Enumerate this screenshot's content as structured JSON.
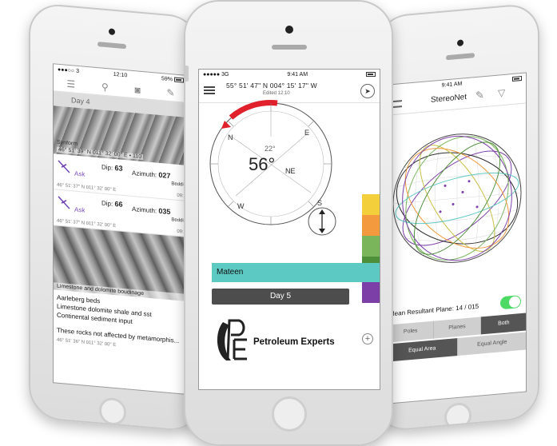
{
  "left_phone": {
    "status": {
      "carrier": "●●●○○ 3",
      "time": "12:10",
      "battery": "59%"
    },
    "day_label": "Day 4",
    "top_image": {
      "caption_title": "Synform",
      "caption_coord": "46° 51' 39\" N  011° 32' 00\" E  • 110",
      "time": "09:4"
    },
    "observations": [
      {
        "ask": "Ask",
        "dip_label": "Dip:",
        "dip_value": "63",
        "az_label": "Azimuth:",
        "az_value": "027",
        "type": "Beddin",
        "coord": "46° 51' 37\" N  011° 32' 00\" E",
        "time": "09:3"
      },
      {
        "ask": "Ask",
        "dip_label": "Dip:",
        "dip_value": "66",
        "az_label": "Azimuth:",
        "az_value": "035",
        "type": "Beddin",
        "coord": "46° 51' 37\" N  011° 32' 00\" E",
        "time": "09:3"
      }
    ],
    "bottom_image": {
      "caption": "Limestone and dolomite boudinage"
    },
    "notes": [
      "Aarleberg beds",
      "Limestone dolomite shale and sst",
      "Continental sediment input"
    ],
    "notes_extra": "These rocks not affected by metamorphis...",
    "footer_coord": "46° 51' 36\" N  011° 32' 00\" E"
  },
  "center_phone": {
    "status": {
      "carrier": "●●●●● 3G",
      "time": "9:41 AM",
      "battery": ""
    },
    "coords": "55° 51' 47\" N   004° 15' 17\" W",
    "edited": "Edited 12:10",
    "compass": {
      "dip_angle": "22°",
      "strike_value": "56°",
      "strike_dir": "NE",
      "cardinal_n": "N",
      "cardinal_e": "E",
      "cardinal_s": "S",
      "cardinal_w": "W"
    },
    "colorbar": [
      "#f3cf3c",
      "#f49a3e",
      "#7ab55c",
      "#4e8f3a",
      "#7c3fa8"
    ],
    "mateen_label": "Mateen",
    "day_button": "Day 5",
    "logo_text": "Petroleum Experts"
  },
  "right_phone": {
    "status": {
      "time": "9:41 AM"
    },
    "title": "StereoNet",
    "mean_label": "Mean Resultant Plane:",
    "mean_value": "14 / 015",
    "toggle_on": true,
    "segment1": [
      "Poles",
      "Planes",
      "Both"
    ],
    "segment2": [
      "Equal Area",
      "Equal Angle"
    ]
  },
  "colors": {
    "accent_teal": "#5dc9c3",
    "compass_red": "#e0202a",
    "toggle_green": "#4cd964",
    "ask_purple": "#7a4bbf"
  }
}
